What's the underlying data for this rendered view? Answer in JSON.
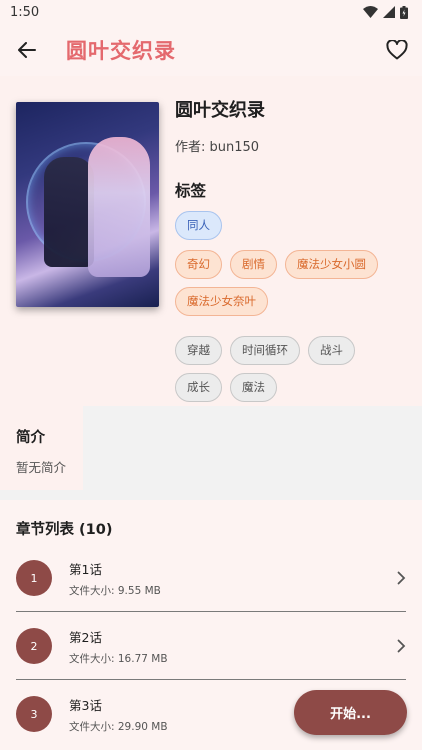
{
  "status_bar": {
    "time": "1:50"
  },
  "app_bar": {
    "title": "圆叶交织录"
  },
  "book": {
    "title": "圆叶交织录",
    "author": "作者: bun150",
    "tags_heading": "标签",
    "tag_groups": [
      [
        "同人"
      ],
      [
        "奇幻",
        "剧情",
        "魔法少女小圆",
        "魔法少女奈叶"
      ],
      [
        "穿越",
        "时间循环",
        "战斗",
        "成长",
        "魔法"
      ]
    ]
  },
  "intro": {
    "title": "简介",
    "text": "暂无简介"
  },
  "chapters": {
    "title": "章节列表 (10)",
    "items": [
      {
        "num": "1",
        "name": "第1话",
        "size": "文件大小: 9.55 MB"
      },
      {
        "num": "2",
        "name": "第2话",
        "size": "文件大小: 16.77 MB"
      },
      {
        "num": "3",
        "name": "第3话",
        "size": "文件大小: 29.90 MB"
      }
    ]
  },
  "fab": {
    "label": "开始..."
  },
  "colors": {
    "accent": "#e4696e",
    "primary": "#8e4a47",
    "background": "#fdf3f2"
  }
}
